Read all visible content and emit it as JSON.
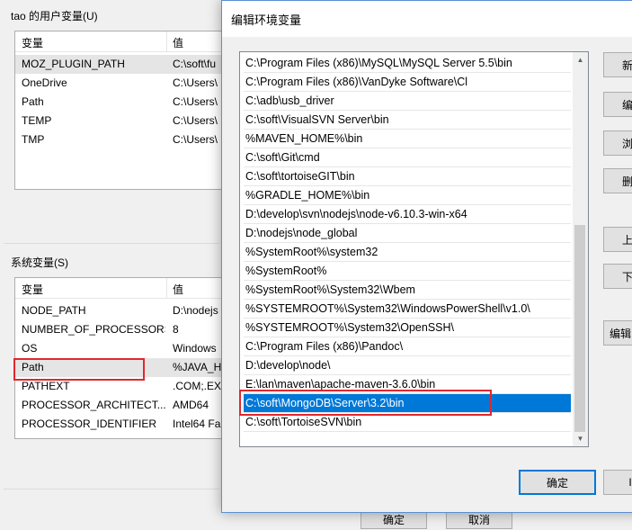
{
  "user_vars": {
    "group_label": "tao 的用户变量(U)",
    "col_variable": "变量",
    "col_value": "值",
    "rows": [
      {
        "name": "MOZ_PLUGIN_PATH",
        "value": "C:\\soft\\fu"
      },
      {
        "name": "OneDrive",
        "value": "C:\\Users\\"
      },
      {
        "name": "Path",
        "value": "C:\\Users\\"
      },
      {
        "name": "TEMP",
        "value": "C:\\Users\\"
      },
      {
        "name": "TMP",
        "value": "C:\\Users\\"
      }
    ]
  },
  "system_vars": {
    "group_label": "系统变量(S)",
    "col_variable": "变量",
    "col_value": "值",
    "rows": [
      {
        "name": "NODE_PATH",
        "value": "D:\\nodejs"
      },
      {
        "name": "NUMBER_OF_PROCESSORS",
        "value": "8"
      },
      {
        "name": "OS",
        "value": "Windows"
      },
      {
        "name": "Path",
        "value": "%JAVA_H"
      },
      {
        "name": "PATHEXT",
        "value": ".COM;.EX"
      },
      {
        "name": "PROCESSOR_ARCHITECT...",
        "value": "AMD64"
      },
      {
        "name": "PROCESSOR_IDENTIFIER",
        "value": "Intel64 Fa"
      }
    ]
  },
  "bg_buttons": {
    "ok": "确定",
    "cancel": "取消"
  },
  "dialog": {
    "title": "编辑环境变量",
    "selected_index": 18,
    "paths": [
      "C:\\Program Files (x86)\\MySQL\\MySQL Server 5.5\\bin",
      "C:\\Program Files (x86)\\VanDyke Software\\Cl",
      "C:\\adb\\usb_driver",
      "C:\\soft\\VisualSVN Server\\bin",
      "%MAVEN_HOME%\\bin",
      "C:\\soft\\Git\\cmd",
      "C:\\soft\\tortoiseGIT\\bin",
      "%GRADLE_HOME%\\bin",
      "D:\\develop\\svn\\nodejs\\node-v6.10.3-win-x64",
      "D:\\nodejs\\node_global",
      "%SystemRoot%\\system32",
      "%SystemRoot%",
      "%SystemRoot%\\System32\\Wbem",
      "%SYSTEMROOT%\\System32\\WindowsPowerShell\\v1.0\\",
      "%SYSTEMROOT%\\System32\\OpenSSH\\",
      "C:\\Program Files (x86)\\Pandoc\\",
      "D:\\develop\\node\\",
      "E:\\lan\\maven\\apache-maven-3.6.0\\bin",
      "C:\\soft\\MongoDB\\Server\\3.2\\bin",
      "C:\\soft\\TortoiseSVN\\bin"
    ],
    "side_buttons": [
      "新",
      "编",
      "浏",
      "删",
      "上",
      "下",
      "编辑"
    ],
    "ok": "确定",
    "cancel": "I"
  }
}
